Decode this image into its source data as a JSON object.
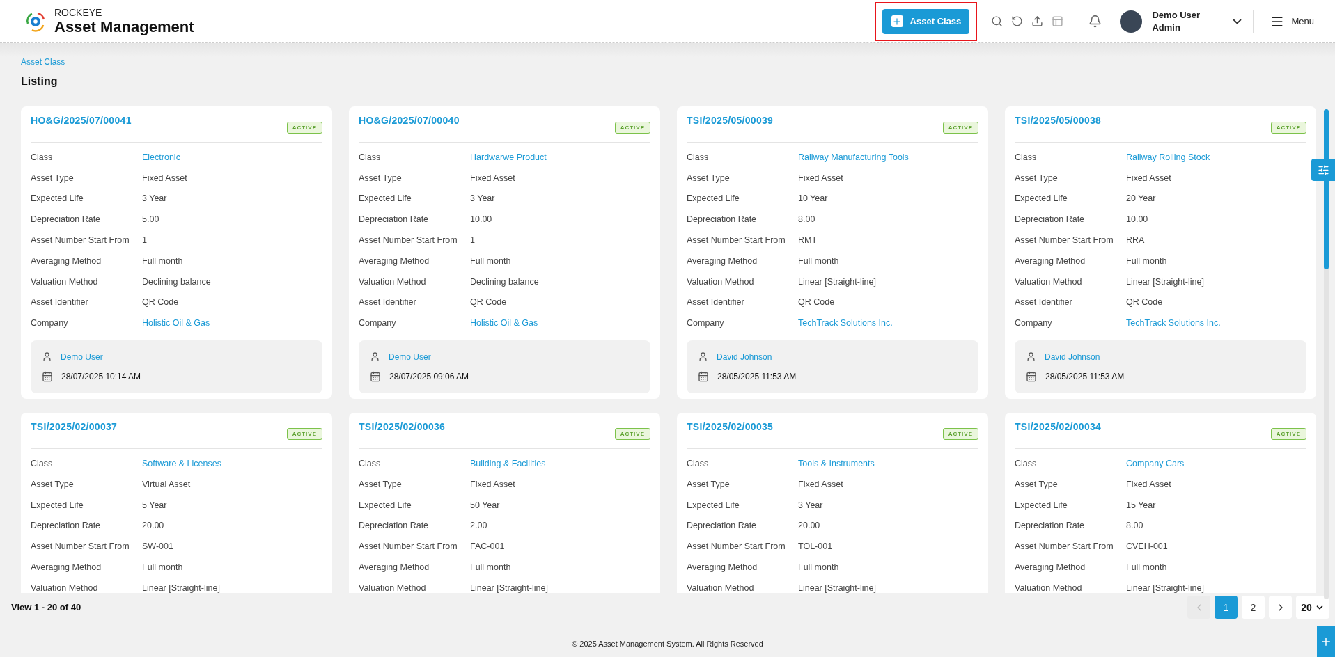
{
  "header": {
    "brand": "ROCKEYE",
    "app_title": "Asset Management",
    "primary_button": "Asset Class",
    "primary_highlighted": true,
    "user": {
      "name": "Demo User",
      "role": "Admin"
    },
    "menu_label": "Menu"
  },
  "breadcrumb": "Asset Class",
  "page_title": "Listing",
  "cards": [
    {
      "code": "HO&G/2025/07/00041",
      "status": "ACTIVE",
      "fields": [
        {
          "label": "Class",
          "value": "Electronic",
          "kind": "link"
        },
        {
          "label": "Asset Type",
          "value": "Fixed Asset",
          "kind": "text"
        },
        {
          "label": "Expected Life",
          "value": "3 Year",
          "kind": "text"
        },
        {
          "label": "Depreciation Rate",
          "value": "5.00",
          "kind": "text"
        },
        {
          "label": "Asset Number Start From",
          "value": "1",
          "kind": "text"
        },
        {
          "label": "Averaging Method",
          "value": "Full month",
          "kind": "text"
        },
        {
          "label": "Valuation Method",
          "value": "Declining balance",
          "kind": "text"
        },
        {
          "label": "Asset Identifier",
          "value": "QR Code",
          "kind": "text"
        },
        {
          "label": "Company",
          "value": "Holistic Oil & Gas",
          "kind": "link"
        }
      ],
      "created_by": "Demo User",
      "created_at": "28/07/2025 10:14 AM"
    },
    {
      "code": "HO&G/2025/07/00040",
      "status": "ACTIVE",
      "fields": [
        {
          "label": "Class",
          "value": "Hardwarwe Product",
          "kind": "link"
        },
        {
          "label": "Asset Type",
          "value": "Fixed Asset",
          "kind": "text"
        },
        {
          "label": "Expected Life",
          "value": "3 Year",
          "kind": "text"
        },
        {
          "label": "Depreciation Rate",
          "value": "10.00",
          "kind": "text"
        },
        {
          "label": "Asset Number Start From",
          "value": "1",
          "kind": "text"
        },
        {
          "label": "Averaging Method",
          "value": "Full month",
          "kind": "text"
        },
        {
          "label": "Valuation Method",
          "value": "Declining balance",
          "kind": "text"
        },
        {
          "label": "Asset Identifier",
          "value": "QR Code",
          "kind": "text"
        },
        {
          "label": "Company",
          "value": "Holistic Oil & Gas",
          "kind": "link"
        }
      ],
      "created_by": "Demo User",
      "created_at": "28/07/2025 09:06 AM"
    },
    {
      "code": "TSI/2025/05/00039",
      "status": "ACTIVE",
      "fields": [
        {
          "label": "Class",
          "value": "Railway Manufacturing Tools",
          "kind": "link"
        },
        {
          "label": "Asset Type",
          "value": "Fixed Asset",
          "kind": "text"
        },
        {
          "label": "Expected Life",
          "value": "10 Year",
          "kind": "text"
        },
        {
          "label": "Depreciation Rate",
          "value": "8.00",
          "kind": "text"
        },
        {
          "label": "Asset Number Start From",
          "value": "RMT",
          "kind": "text"
        },
        {
          "label": "Averaging Method",
          "value": "Full month",
          "kind": "text"
        },
        {
          "label": "Valuation Method",
          "value": "Linear [Straight-line]",
          "kind": "text"
        },
        {
          "label": "Asset Identifier",
          "value": "QR Code",
          "kind": "text"
        },
        {
          "label": "Company",
          "value": "TechTrack Solutions Inc.",
          "kind": "link"
        }
      ],
      "created_by": "David Johnson",
      "created_at": "28/05/2025 11:53 AM"
    },
    {
      "code": "TSI/2025/05/00038",
      "status": "ACTIVE",
      "fields": [
        {
          "label": "Class",
          "value": "Railway Rolling Stock",
          "kind": "link"
        },
        {
          "label": "Asset Type",
          "value": "Fixed Asset",
          "kind": "text"
        },
        {
          "label": "Expected Life",
          "value": "20 Year",
          "kind": "text"
        },
        {
          "label": "Depreciation Rate",
          "value": "10.00",
          "kind": "text"
        },
        {
          "label": "Asset Number Start From",
          "value": "RRA",
          "kind": "text"
        },
        {
          "label": "Averaging Method",
          "value": "Full month",
          "kind": "text"
        },
        {
          "label": "Valuation Method",
          "value": "Linear [Straight-line]",
          "kind": "text"
        },
        {
          "label": "Asset Identifier",
          "value": "QR Code",
          "kind": "text"
        },
        {
          "label": "Company",
          "value": "TechTrack Solutions Inc.",
          "kind": "link"
        }
      ],
      "created_by": "David Johnson",
      "created_at": "28/05/2025 11:53 AM"
    },
    {
      "code": "TSI/2025/02/00037",
      "status": "ACTIVE",
      "fields": [
        {
          "label": "Class",
          "value": "Software & Licenses",
          "kind": "link"
        },
        {
          "label": "Asset Type",
          "value": "Virtual Asset",
          "kind": "text"
        },
        {
          "label": "Expected Life",
          "value": "5 Year",
          "kind": "text"
        },
        {
          "label": "Depreciation Rate",
          "value": "20.00",
          "kind": "text"
        },
        {
          "label": "Asset Number Start From",
          "value": "SW-001",
          "kind": "text"
        },
        {
          "label": "Averaging Method",
          "value": "Full month",
          "kind": "text"
        },
        {
          "label": "Valuation Method",
          "value": "Linear [Straight-line]",
          "kind": "text"
        }
      ]
    },
    {
      "code": "TSI/2025/02/00036",
      "status": "ACTIVE",
      "fields": [
        {
          "label": "Class",
          "value": "Building & Facilities",
          "kind": "link"
        },
        {
          "label": "Asset Type",
          "value": "Fixed Asset",
          "kind": "text"
        },
        {
          "label": "Expected Life",
          "value": "50 Year",
          "kind": "text"
        },
        {
          "label": "Depreciation Rate",
          "value": "2.00",
          "kind": "text"
        },
        {
          "label": "Asset Number Start From",
          "value": "FAC-001",
          "kind": "text"
        },
        {
          "label": "Averaging Method",
          "value": "Full month",
          "kind": "text"
        },
        {
          "label": "Valuation Method",
          "value": "Linear [Straight-line]",
          "kind": "text"
        }
      ]
    },
    {
      "code": "TSI/2025/02/00035",
      "status": "ACTIVE",
      "fields": [
        {
          "label": "Class",
          "value": "Tools & Instruments",
          "kind": "link"
        },
        {
          "label": "Asset Type",
          "value": "Fixed Asset",
          "kind": "text"
        },
        {
          "label": "Expected Life",
          "value": "3 Year",
          "kind": "text"
        },
        {
          "label": "Depreciation Rate",
          "value": "20.00",
          "kind": "text"
        },
        {
          "label": "Asset Number Start From",
          "value": "TOL-001",
          "kind": "text"
        },
        {
          "label": "Averaging Method",
          "value": "Full month",
          "kind": "text"
        },
        {
          "label": "Valuation Method",
          "value": "Linear [Straight-line]",
          "kind": "text"
        }
      ]
    },
    {
      "code": "TSI/2025/02/00034",
      "status": "ACTIVE",
      "fields": [
        {
          "label": "Class",
          "value": "Company Cars",
          "kind": "link"
        },
        {
          "label": "Asset Type",
          "value": "Fixed Asset",
          "kind": "text"
        },
        {
          "label": "Expected Life",
          "value": "15 Year",
          "kind": "text"
        },
        {
          "label": "Depreciation Rate",
          "value": "8.00",
          "kind": "text"
        },
        {
          "label": "Asset Number Start From",
          "value": "CVEH-001",
          "kind": "text"
        },
        {
          "label": "Averaging Method",
          "value": "Full month",
          "kind": "text"
        },
        {
          "label": "Valuation Method",
          "value": "Linear [Straight-line]",
          "kind": "text"
        }
      ]
    }
  ],
  "record_count": "View 1 - 20 of 40",
  "pagination": {
    "pages": [
      {
        "label": "1",
        "selected": true
      },
      {
        "label": "2",
        "selected": false
      }
    ],
    "prev_disabled": true,
    "next_disabled": false,
    "page_size": "20"
  },
  "footer": "© 2025 Asset Management System. All Rights Reserved"
}
